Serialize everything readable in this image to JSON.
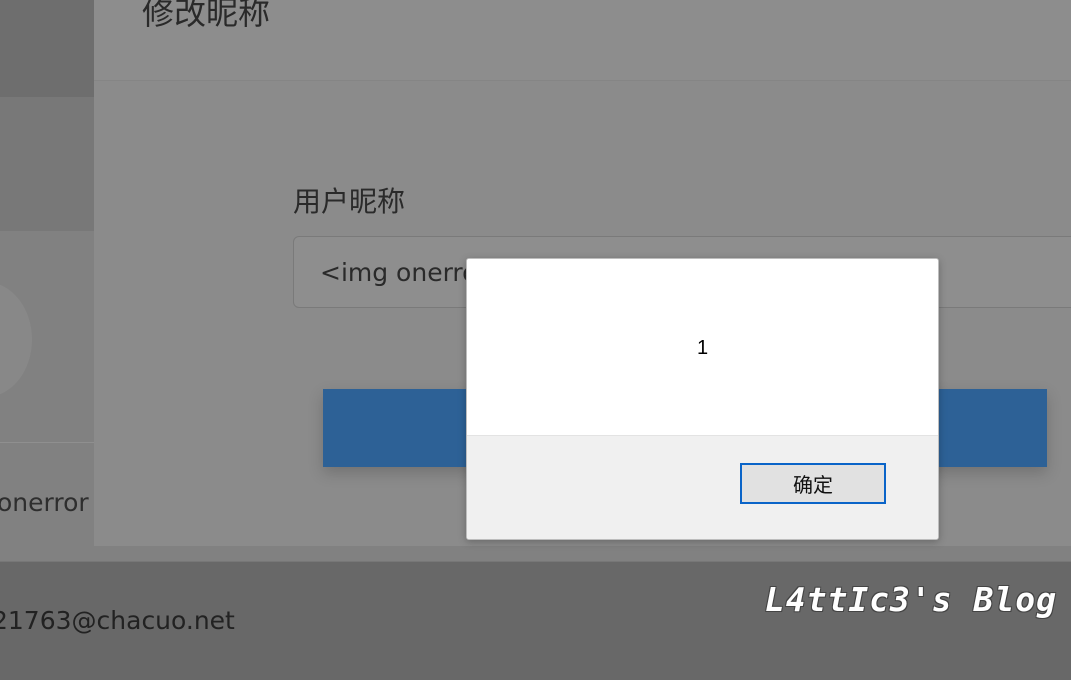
{
  "modal": {
    "title": "修改昵称",
    "field_label": "用户昵称",
    "nickname_value": "<img onerror"
  },
  "background": {
    "onerror_text": "onerror",
    "email_text": "21763@chacuo.net"
  },
  "alert": {
    "message": "1",
    "ok_label": "确定"
  },
  "watermark": {
    "text": "L4ttIc3's Blog"
  },
  "colors": {
    "primary_button": "#2d6196",
    "ok_button_border": "#0a64c8",
    "overlay_dim": "#6b6b6b"
  }
}
